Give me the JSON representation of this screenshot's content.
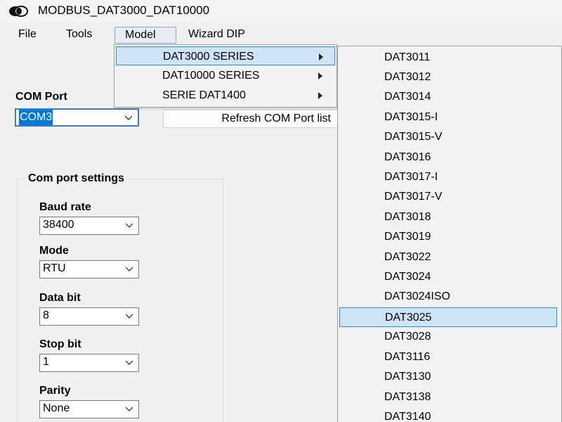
{
  "window": {
    "title": "MODBUS_DAT3000_DAT10000"
  },
  "menubar": {
    "items": [
      "File",
      "Tools",
      "Model",
      "Wizard DIP"
    ]
  },
  "com_port": {
    "label": "COM Port",
    "value": "COM3"
  },
  "refresh_button": {
    "label": "Refresh COM Port list"
  },
  "com_settings": {
    "title": "Com port settings",
    "baud_rate": {
      "label": "Baud rate",
      "value": "38400"
    },
    "mode": {
      "label": "Mode",
      "value": "RTU"
    },
    "data_bit": {
      "label": "Data bit",
      "value": "8"
    },
    "stop_bit": {
      "label": "Stop bit",
      "value": "1"
    },
    "parity": {
      "label": "Parity",
      "value": "None"
    }
  },
  "model_menu": {
    "items": [
      "DAT3000 SERIES",
      "DAT10000 SERIES",
      "SERIE DAT1400"
    ],
    "highlighted": "DAT3000 SERIES"
  },
  "series_submenu": {
    "items": [
      "DAT3011",
      "DAT3012",
      "DAT3014",
      "DAT3015-I",
      "DAT3015-V",
      "DAT3016",
      "DAT3017-I",
      "DAT3017-V",
      "DAT3018",
      "DAT3019",
      "DAT3022",
      "DAT3024",
      "DAT3024ISO",
      "DAT3025",
      "DAT3028",
      "DAT3116",
      "DAT3130",
      "DAT3138",
      "DAT3140"
    ],
    "highlighted": "DAT3025"
  },
  "colors": {
    "highlight_bg": "#cde4f7",
    "highlight_border": "#2f8ad1",
    "selection": "#0078d7"
  }
}
